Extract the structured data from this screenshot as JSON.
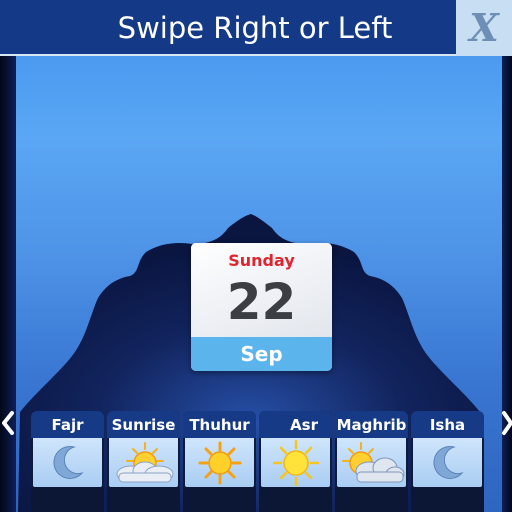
{
  "header": {
    "title": "Swipe Right or Left",
    "close_label": "X"
  },
  "calendar": {
    "day_of_week": "Sunday",
    "day": "22",
    "month": "Sep"
  },
  "prayers": [
    {
      "name": "Fajr",
      "icon": "crescent-moon-icon"
    },
    {
      "name": "Sunrise",
      "icon": "sun-with-clouds-icon"
    },
    {
      "name": "Thuhur",
      "icon": "sun-icon"
    },
    {
      "name": "Asr",
      "icon": "sun-icon"
    },
    {
      "name": "Maghrib",
      "icon": "sun-with-clouds-icon"
    },
    {
      "name": "Isha",
      "icon": "crescent-moon-icon"
    }
  ],
  "colors": {
    "header": "#143a87",
    "accent_red": "#e0252f",
    "calendar_month_bar": "#5cb4ec",
    "sky_light": "#5aa7f4",
    "dome": "#0e1a4a"
  }
}
